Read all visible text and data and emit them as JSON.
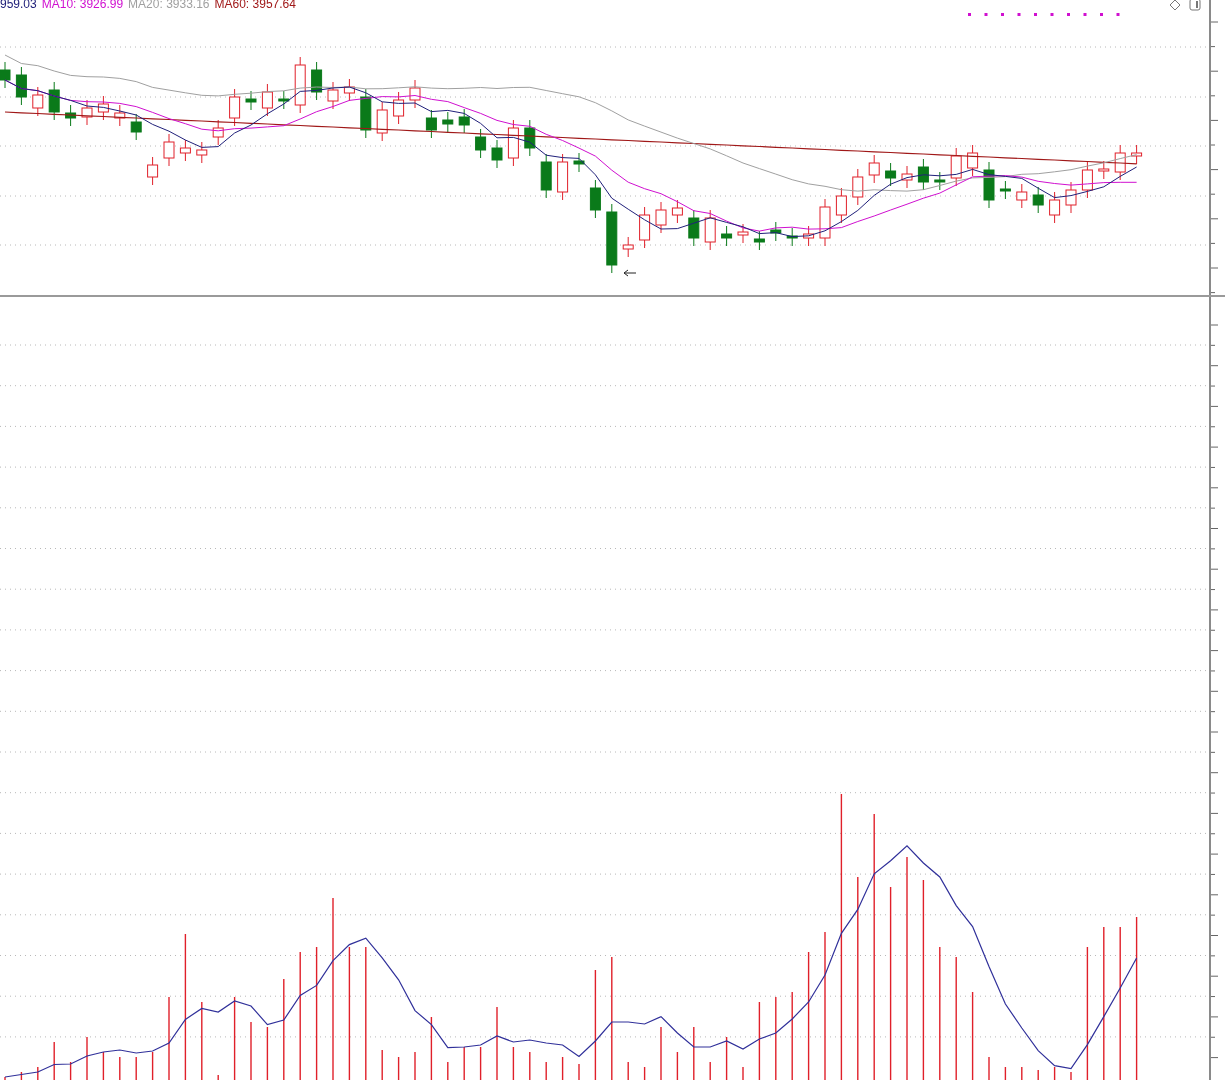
{
  "legend": [
    {
      "text": "959.03",
      "color": "#20207a"
    },
    {
      "text": "MA10: 3926.99",
      "color": "#d010d0"
    },
    {
      "text": "MA20: 3933.16",
      "color": "#a0a0a0"
    },
    {
      "text": "MA60: 3957.64",
      "color": "#a01818"
    }
  ]
}
